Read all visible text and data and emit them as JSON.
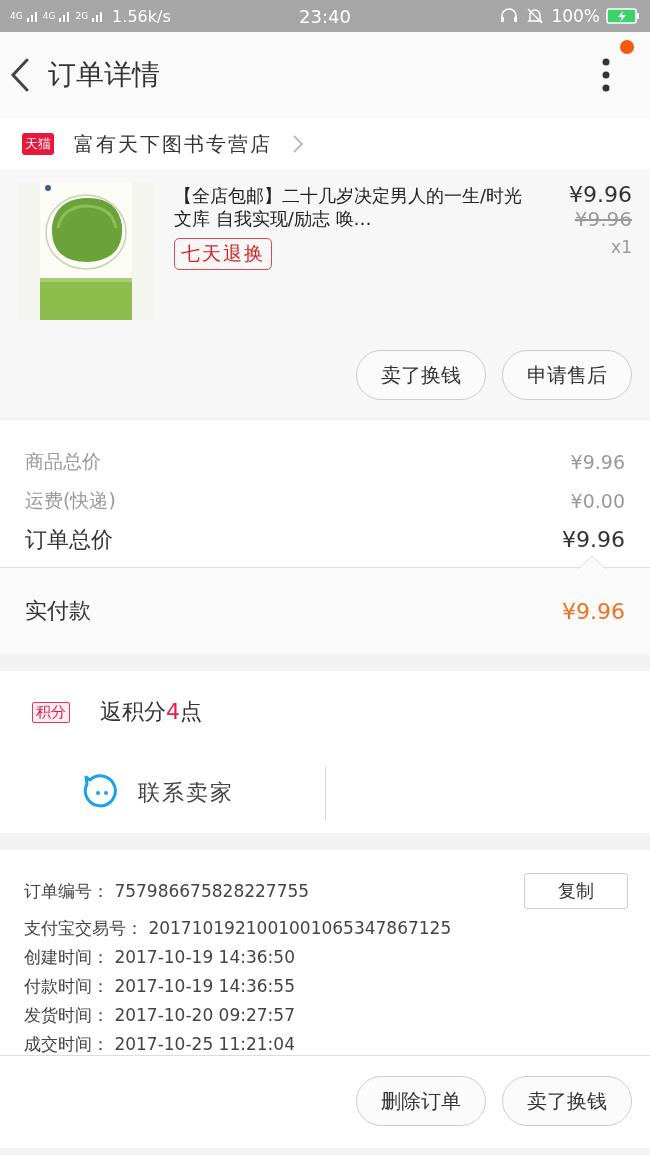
{
  "status_bar": {
    "network": [
      "4G",
      "4G",
      "2G"
    ],
    "speed": "1.56k/s",
    "time": "23:40",
    "battery": "100%",
    "charging": true
  },
  "header": {
    "title": "订单详情",
    "notification_dot": true
  },
  "store": {
    "badge": "天猫",
    "name": "富有天下图书专营店"
  },
  "items": [
    {
      "title": "【全店包邮】二十几岁决定男人的一生/时光文库 自我实现/励志 唤…",
      "tag": "七天退换",
      "price": "¥9.96",
      "original_price": "¥9.96",
      "quantity": "x1"
    }
  ],
  "item_actions": [
    "卖了换钱",
    "申请售后"
  ],
  "summary": [
    {
      "label": "商品总价",
      "value": "¥9.96",
      "kind": "minor"
    },
    {
      "label": "运费(快递)",
      "value": "¥0.00",
      "kind": "minor"
    },
    {
      "label": "订单总价",
      "value": "¥9.96",
      "kind": "major"
    }
  ],
  "payment": {
    "label": "实付款",
    "value": "¥9.96"
  },
  "points": {
    "badge": "积分",
    "text_before": "返积分",
    "number": "4",
    "text_after": "点"
  },
  "contact": {
    "label": "联系卖家"
  },
  "order_info": [
    {
      "label": "订单编号：",
      "value": "757986675828227755",
      "copy_button": "复制"
    },
    {
      "label": "支付宝交易号：",
      "value": "2017101921001001065347867125"
    },
    {
      "label": "创建时间：",
      "value": "2017-10-19 14:36:50"
    },
    {
      "label": "付款时间：",
      "value": "2017-10-19 14:36:55"
    },
    {
      "label": "发货时间：",
      "value": "2017-10-20 09:27:57"
    },
    {
      "label": "成交时间：",
      "value": "2017-10-25 11:21:04"
    }
  ],
  "bottom_actions": [
    "删除订单",
    "卖了换钱"
  ]
}
